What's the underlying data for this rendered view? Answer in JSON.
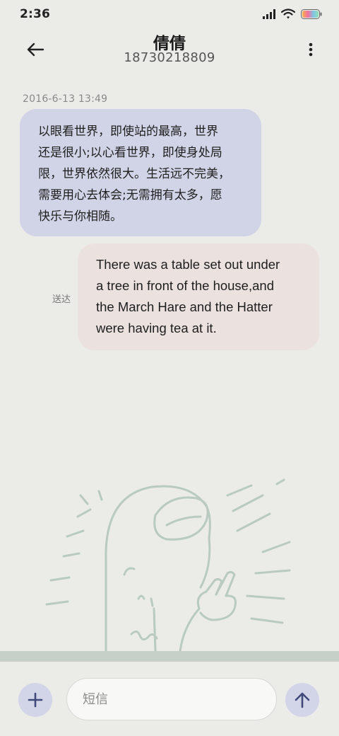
{
  "status_bar": {
    "time": "2:36",
    "icons": [
      "signal-icon",
      "wifi-icon",
      "battery-icon"
    ]
  },
  "header": {
    "contact_name": "倩倩",
    "contact_number": "18730218809",
    "back_icon": "back-arrow-icon",
    "menu_icon": "more-vertical-icon"
  },
  "conversation": {
    "timestamp": "2016-6-13 13:49",
    "messages": [
      {
        "direction": "incoming",
        "lines": [
          "以眼看世界，即使站的最高，世界",
          "还是很小;以心看世界，即使身处局",
          "限，世界依然很大。生活远不完美，",
          "需要用心去体会;无需拥有太多，愿",
          "快乐与你相随。"
        ]
      },
      {
        "direction": "outgoing",
        "status": "送达",
        "lines": [
          "There was a table set out under",
          "a tree in front of the house,and",
          "the March Hare and the Hatter",
          "were having tea at it."
        ]
      }
    ]
  },
  "composer": {
    "placeholder": "短信",
    "value": "",
    "add_icon": "plus-icon",
    "send_icon": "send-arrow-up-icon"
  },
  "colors": {
    "background": "#ebebe8",
    "incoming_bubble": "#d0d4e6",
    "outgoing_bubble": "#ebe2df",
    "accent": "#3f4a7a",
    "illustration": "#b9cbc1"
  }
}
